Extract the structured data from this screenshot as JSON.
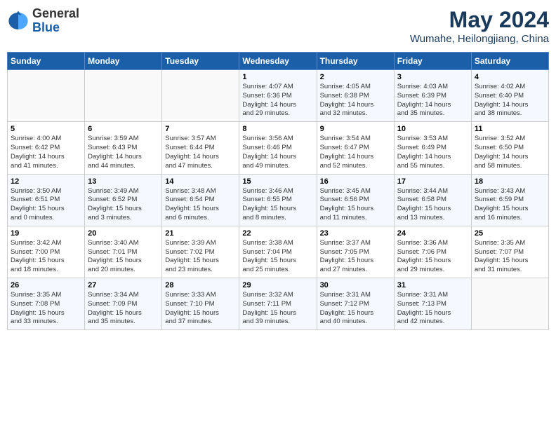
{
  "header": {
    "logo_general": "General",
    "logo_blue": "Blue",
    "month_year": "May 2024",
    "location": "Wumahe, Heilongjiang, China"
  },
  "weekdays": [
    "Sunday",
    "Monday",
    "Tuesday",
    "Wednesday",
    "Thursday",
    "Friday",
    "Saturday"
  ],
  "weeks": [
    [
      {
        "day": "",
        "info": ""
      },
      {
        "day": "",
        "info": ""
      },
      {
        "day": "",
        "info": ""
      },
      {
        "day": "1",
        "info": "Sunrise: 4:07 AM\nSunset: 6:36 PM\nDaylight: 14 hours\nand 29 minutes."
      },
      {
        "day": "2",
        "info": "Sunrise: 4:05 AM\nSunset: 6:38 PM\nDaylight: 14 hours\nand 32 minutes."
      },
      {
        "day": "3",
        "info": "Sunrise: 4:03 AM\nSunset: 6:39 PM\nDaylight: 14 hours\nand 35 minutes."
      },
      {
        "day": "4",
        "info": "Sunrise: 4:02 AM\nSunset: 6:40 PM\nDaylight: 14 hours\nand 38 minutes."
      }
    ],
    [
      {
        "day": "5",
        "info": "Sunrise: 4:00 AM\nSunset: 6:42 PM\nDaylight: 14 hours\nand 41 minutes."
      },
      {
        "day": "6",
        "info": "Sunrise: 3:59 AM\nSunset: 6:43 PM\nDaylight: 14 hours\nand 44 minutes."
      },
      {
        "day": "7",
        "info": "Sunrise: 3:57 AM\nSunset: 6:44 PM\nDaylight: 14 hours\nand 47 minutes."
      },
      {
        "day": "8",
        "info": "Sunrise: 3:56 AM\nSunset: 6:46 PM\nDaylight: 14 hours\nand 49 minutes."
      },
      {
        "day": "9",
        "info": "Sunrise: 3:54 AM\nSunset: 6:47 PM\nDaylight: 14 hours\nand 52 minutes."
      },
      {
        "day": "10",
        "info": "Sunrise: 3:53 AM\nSunset: 6:49 PM\nDaylight: 14 hours\nand 55 minutes."
      },
      {
        "day": "11",
        "info": "Sunrise: 3:52 AM\nSunset: 6:50 PM\nDaylight: 14 hours\nand 58 minutes."
      }
    ],
    [
      {
        "day": "12",
        "info": "Sunrise: 3:50 AM\nSunset: 6:51 PM\nDaylight: 15 hours\nand 0 minutes."
      },
      {
        "day": "13",
        "info": "Sunrise: 3:49 AM\nSunset: 6:52 PM\nDaylight: 15 hours\nand 3 minutes."
      },
      {
        "day": "14",
        "info": "Sunrise: 3:48 AM\nSunset: 6:54 PM\nDaylight: 15 hours\nand 6 minutes."
      },
      {
        "day": "15",
        "info": "Sunrise: 3:46 AM\nSunset: 6:55 PM\nDaylight: 15 hours\nand 8 minutes."
      },
      {
        "day": "16",
        "info": "Sunrise: 3:45 AM\nSunset: 6:56 PM\nDaylight: 15 hours\nand 11 minutes."
      },
      {
        "day": "17",
        "info": "Sunrise: 3:44 AM\nSunset: 6:58 PM\nDaylight: 15 hours\nand 13 minutes."
      },
      {
        "day": "18",
        "info": "Sunrise: 3:43 AM\nSunset: 6:59 PM\nDaylight: 15 hours\nand 16 minutes."
      }
    ],
    [
      {
        "day": "19",
        "info": "Sunrise: 3:42 AM\nSunset: 7:00 PM\nDaylight: 15 hours\nand 18 minutes."
      },
      {
        "day": "20",
        "info": "Sunrise: 3:40 AM\nSunset: 7:01 PM\nDaylight: 15 hours\nand 20 minutes."
      },
      {
        "day": "21",
        "info": "Sunrise: 3:39 AM\nSunset: 7:02 PM\nDaylight: 15 hours\nand 23 minutes."
      },
      {
        "day": "22",
        "info": "Sunrise: 3:38 AM\nSunset: 7:04 PM\nDaylight: 15 hours\nand 25 minutes."
      },
      {
        "day": "23",
        "info": "Sunrise: 3:37 AM\nSunset: 7:05 PM\nDaylight: 15 hours\nand 27 minutes."
      },
      {
        "day": "24",
        "info": "Sunrise: 3:36 AM\nSunset: 7:06 PM\nDaylight: 15 hours\nand 29 minutes."
      },
      {
        "day": "25",
        "info": "Sunrise: 3:35 AM\nSunset: 7:07 PM\nDaylight: 15 hours\nand 31 minutes."
      }
    ],
    [
      {
        "day": "26",
        "info": "Sunrise: 3:35 AM\nSunset: 7:08 PM\nDaylight: 15 hours\nand 33 minutes."
      },
      {
        "day": "27",
        "info": "Sunrise: 3:34 AM\nSunset: 7:09 PM\nDaylight: 15 hours\nand 35 minutes."
      },
      {
        "day": "28",
        "info": "Sunrise: 3:33 AM\nSunset: 7:10 PM\nDaylight: 15 hours\nand 37 minutes."
      },
      {
        "day": "29",
        "info": "Sunrise: 3:32 AM\nSunset: 7:11 PM\nDaylight: 15 hours\nand 39 minutes."
      },
      {
        "day": "30",
        "info": "Sunrise: 3:31 AM\nSunset: 7:12 PM\nDaylight: 15 hours\nand 40 minutes."
      },
      {
        "day": "31",
        "info": "Sunrise: 3:31 AM\nSunset: 7:13 PM\nDaylight: 15 hours\nand 42 minutes."
      },
      {
        "day": "",
        "info": ""
      }
    ]
  ]
}
